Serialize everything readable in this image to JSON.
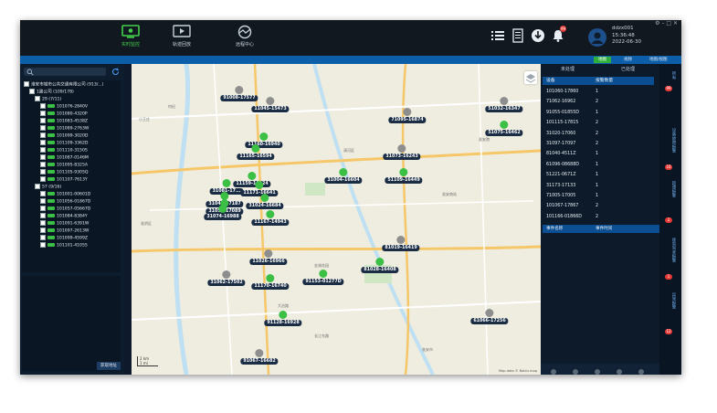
{
  "nav": [
    {
      "label": "实时监控",
      "icon": "monitor-icon",
      "active": true
    },
    {
      "label": "轨迹回放",
      "icon": "playback-icon",
      "active": false
    },
    {
      "label": "远程中心",
      "icon": "remote-center-icon",
      "active": false
    }
  ],
  "toolbar": {
    "list_icon": "list-icon",
    "doc_icon": "document-icon",
    "download_icon": "download-icon",
    "bell_icon": "bell-icon",
    "bell_badge": "99"
  },
  "user": {
    "name": "ddzx001",
    "time": "15:36:48",
    "date": "2022-06-30"
  },
  "view_tabs": [
    "地图",
    "视频",
    "地图/视图"
  ],
  "tree": {
    "root": "淮安市城市公共交通有限公司 (913/...)",
    "branch1": "1路公司 (109/178)",
    "group1": "29 (7/11)",
    "vehicles1": [
      "101076-2840V",
      "101080-4320P",
      "101083-4538Z",
      "101089-2763W",
      "101099-3020D",
      "101109-3362D",
      "101110-3150S",
      "101087-0146M",
      "101095-8325A",
      "101105-9305Q",
      "101107-7613Y"
    ],
    "group2": "57 (9/16)",
    "vehicles2": [
      "101001-00601D",
      "101056-01867D",
      "101057-05667D",
      "101084-8384Y",
      "101091-6391W",
      "101097-2613W",
      "101099-4599Z",
      "101101-41055"
    ],
    "get_address": "获取地址"
  },
  "map_markers": [
    {
      "label": "91008-17577",
      "color": "#8e8e8e"
    },
    {
      "label": "11045-15473",
      "color": "#8e8e8e"
    },
    {
      "label": "11160-16940",
      "color": "#3bbf44"
    },
    {
      "label": "11165-16594",
      "color": "#3bbf44"
    },
    {
      "label": "71095-16874",
      "color": "#8e8e8e"
    },
    {
      "label": "51032-16347",
      "color": "#8e8e8e"
    },
    {
      "label": "51075-16462",
      "color": "#3bbf44"
    },
    {
      "label": "31073-16243",
      "color": "#8e8e8e"
    },
    {
      "label": "31004-16604",
      "color": "#3bbf44"
    },
    {
      "label": "51109-16449",
      "color": "#3bbf44"
    },
    {
      "label": "11159-16924",
      "color": "#3bbf44"
    },
    {
      "label": "11171-16641",
      "color": "#3bbf44"
    },
    {
      "label": "31081-17...",
      "color": "#3bbf44"
    },
    {
      "label": "31047-17187",
      "color": "#3bbf44"
    },
    {
      "label": "31059-17089",
      "color": "#3bbf44"
    },
    {
      "label": "31024-16684",
      "color": "#3bbf44"
    },
    {
      "label": "31074-16988",
      "color": "#3bbf44"
    },
    {
      "label": "11167-14943",
      "color": "#3bbf44"
    },
    {
      "label": "81019-16419",
      "color": "#8e8e8e"
    },
    {
      "label": "11026-16966",
      "color": "#8e8e8e"
    },
    {
      "label": "81028-16408",
      "color": "#3bbf44"
    },
    {
      "label": "31062-17502",
      "color": "#8e8e8e"
    },
    {
      "label": "11170-16740",
      "color": "#3bbf44"
    },
    {
      "label": "91153-01277D",
      "color": "#3bbf44"
    },
    {
      "label": "61066-17256",
      "color": "#8e8e8e"
    },
    {
      "label": "91128-16928",
      "color": "#3bbf44"
    },
    {
      "label": "91067-16682",
      "color": "#8e8e8e"
    }
  ],
  "map_places": [
    "何纪",
    "小王庄",
    "清河区",
    "淮阴区",
    "淮安港",
    "金湖花园",
    "大治路",
    "淮安南站",
    "长江东路",
    "准安市"
  ],
  "map_scale": "2 km",
  "map_scale_small": "1 mi",
  "map_copyright": "Map data © Baidu map",
  "alarm_panel": {
    "tabs": [
      "未处理",
      "已处理"
    ],
    "col_device": "设备",
    "col_count": "报警数量",
    "rows": [
      {
        "device": "101060-17860",
        "count": "1"
      },
      {
        "device": "71062-16962",
        "count": "2"
      },
      {
        "device": "91055-01855D",
        "count": "1"
      },
      {
        "device": "101115-17815",
        "count": "2"
      },
      {
        "device": "31020-17060",
        "count": "2"
      },
      {
        "device": "31097-17097",
        "count": "2"
      },
      {
        "device": "81040-4511Z",
        "count": "1"
      },
      {
        "device": "61096-08688D",
        "count": "1"
      },
      {
        "device": "51221-0671Z",
        "count": "1"
      },
      {
        "device": "31173-17133",
        "count": "1"
      },
      {
        "device": "71005-17005",
        "count": "1"
      },
      {
        "device": "101067-17867",
        "count": "2"
      },
      {
        "device": "101166-01866D",
        "count": "2"
      }
    ],
    "event_name": "事件名称",
    "event_time": "事件时间"
  },
  "side_tabs": [
    {
      "label": "所有",
      "badge": "99"
    },
    {
      "label": "设备故障报警",
      "badge": "16"
    },
    {
      "label": "超速报警",
      "badge": "2"
    },
    {
      "label": "疲劳驾驶报警",
      "badge": "1"
    },
    {
      "label": "异常报警",
      "badge": "12"
    }
  ]
}
